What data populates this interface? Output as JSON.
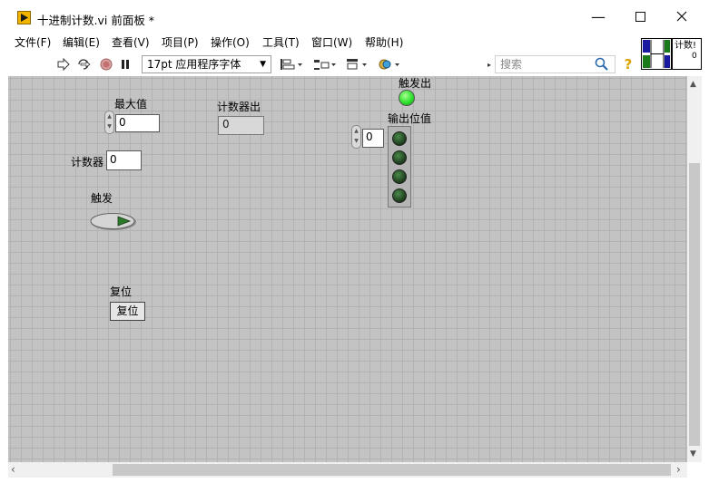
{
  "window": {
    "title": "十进制计数.vi 前面板 *"
  },
  "menu": [
    "文件(F)",
    "编辑(E)",
    "查看(V)",
    "项目(P)",
    "操作(O)",
    "工具(T)",
    "窗口(W)",
    "帮助(H)"
  ],
  "toolbar": {
    "font": "17pt 应用程序字体",
    "search_placeholder": "搜索",
    "icons": [
      "run-arrow-icon",
      "run-continuously-icon",
      "abort-icon",
      "pause-icon",
      "align-icon",
      "distribute-icon",
      "resize-icon",
      "reorder-icon",
      "search-icon",
      "help-icon"
    ]
  },
  "vi_icon": {
    "text": "计数!",
    "value": "0"
  },
  "controls": {
    "max_value": {
      "label": "最大值",
      "value": "0"
    },
    "counter": {
      "label": "计数器",
      "value": "0"
    },
    "counter_out": {
      "label": "计数器出",
      "value": "0"
    },
    "trigger": {
      "label": "触发"
    },
    "trigger_out": {
      "label": "触发出"
    },
    "output_bits": {
      "label": "输出位值",
      "index": "0",
      "leds": [
        false,
        false,
        false,
        false
      ]
    },
    "reset": {
      "label": "复位",
      "button_text": "复位"
    }
  },
  "colors": {
    "panel_bg": "#c3c3c3",
    "grid": "#b2b2b2",
    "led_on": "#2ee02e",
    "led_off": "#1c3a1c",
    "icon_accent": "#f2b400"
  }
}
